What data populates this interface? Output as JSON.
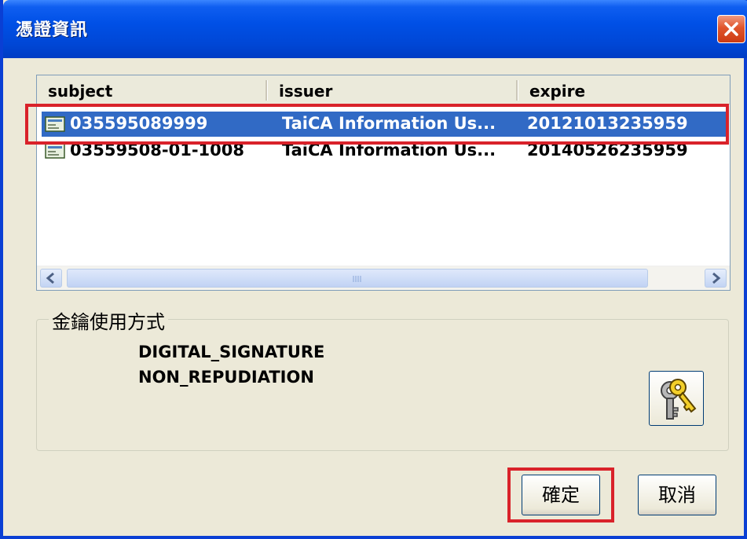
{
  "window": {
    "title": "憑證資訊"
  },
  "list": {
    "columns": [
      "subject",
      "issuer",
      "expire"
    ],
    "rows": [
      {
        "subject": "035595089999",
        "issuer": "TaiCA Information Us...",
        "expire": "20121013235959",
        "selected": true
      },
      {
        "subject": "03559508-01-1008",
        "issuer": "TaiCA Information Us...",
        "expire": "20140526235959",
        "selected": false
      }
    ]
  },
  "key_usage": {
    "label": "金鑰使用方式",
    "items": [
      "DIGITAL_SIGNATURE",
      "NON_REPUDIATION"
    ]
  },
  "buttons": {
    "ok": "確定",
    "cancel": "取消"
  },
  "colors": {
    "selection": "#316ac5",
    "highlight_box": "#d9222a",
    "titlebar": "#0050e6"
  },
  "icons": [
    "close-icon",
    "certificate-icon",
    "keys-icon",
    "scroll-left-icon",
    "scroll-right-icon"
  ]
}
